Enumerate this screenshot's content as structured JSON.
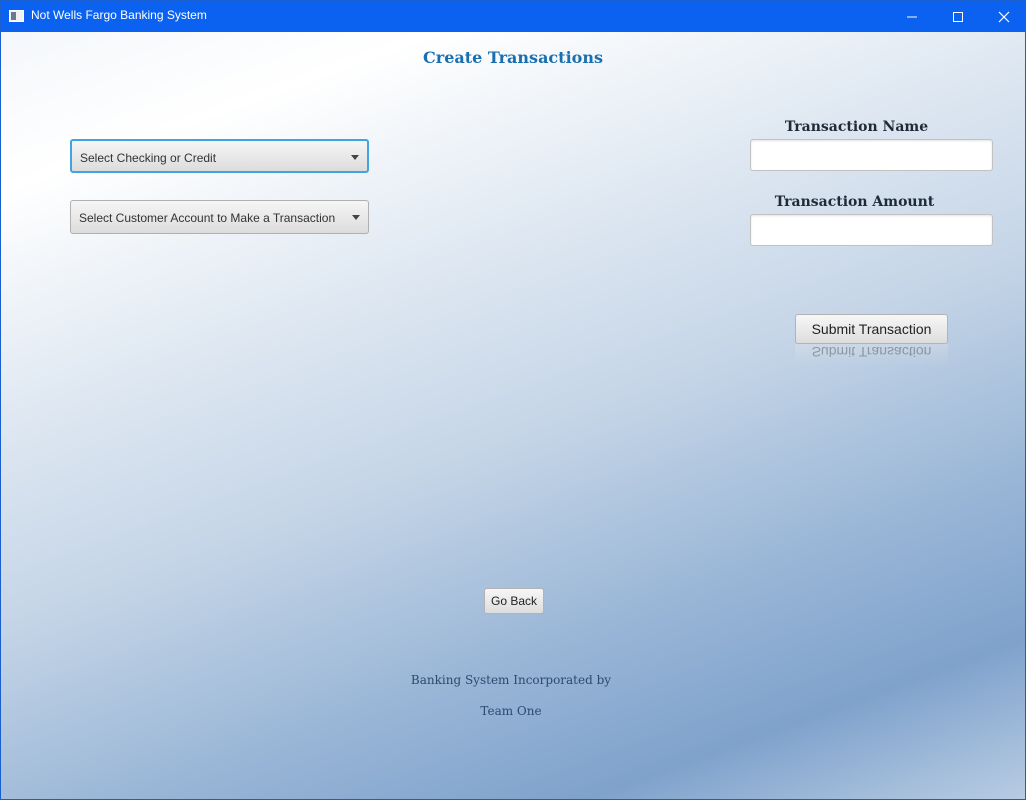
{
  "window": {
    "title": "Not Wells Fargo Banking System",
    "icon": "app-window-icon",
    "controls": [
      "minimize-icon",
      "maximize-icon",
      "close-icon"
    ]
  },
  "page": {
    "title": "Create Transactions"
  },
  "form": {
    "account_type_select": {
      "selected": "Select Checking or Credit"
    },
    "customer_account_select": {
      "selected": "Select Customer Account to Make a Transaction"
    },
    "transaction_name": {
      "label": "Transaction Name",
      "value": ""
    },
    "transaction_amount": {
      "label": "Transaction Amount",
      "value": ""
    },
    "submit_label": "Submit Transaction"
  },
  "navigation": {
    "back_label": "Go Back"
  },
  "footer": {
    "line1": "Banking System Incorporated by",
    "line2": "Team One"
  },
  "colors": {
    "titlebar": "#0b62f0",
    "page_title": "#1a6fb0",
    "focus_border": "#3fa4e0"
  }
}
